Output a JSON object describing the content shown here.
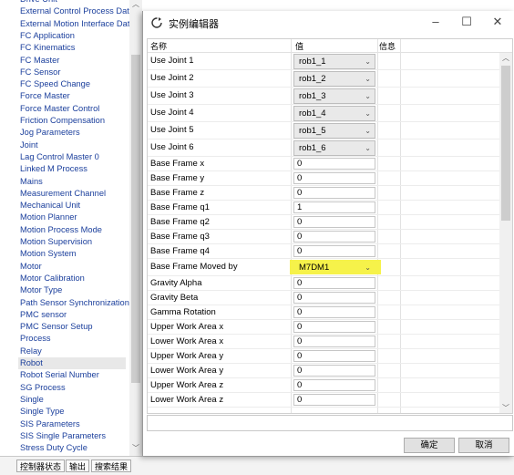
{
  "left_list": {
    "items": [
      "Drive Unit",
      "External Control Process Data",
      "External Motion Interface Data",
      "FC Application",
      "FC Kinematics",
      "FC Master",
      "FC Sensor",
      "FC Speed Change",
      "Force Master",
      "Force Master Control",
      "Friction Compensation",
      "Jog Parameters",
      "Joint",
      "Lag Control Master 0",
      "Linked M Process",
      "Mains",
      "Measurement Channel",
      "Mechanical Unit",
      "Motion Planner",
      "Motion Process Mode",
      "Motion Supervision",
      "Motion System",
      "Motor",
      "Motor Calibration",
      "Motor Type",
      "Path Sensor Synchronization",
      "PMC sensor",
      "PMC Sensor Setup",
      "Process",
      "Relay",
      "Robot",
      "Robot Serial Number",
      "SG Process",
      "Single",
      "Single Type",
      "SIS Parameters",
      "SIS Single Parameters",
      "Stress Duty Cycle"
    ],
    "selected": "Robot"
  },
  "bottom_tabs": [
    "控制器状态",
    "输出",
    "搜索结果"
  ],
  "dialog": {
    "title": "实例编辑器",
    "columns": {
      "name": "名称",
      "value": "值",
      "info": "信息"
    },
    "rows": [
      {
        "name": "Use Joint 1",
        "value": "rob1_1",
        "type": "select"
      },
      {
        "name": "Use Joint 2",
        "value": "rob1_2",
        "type": "select"
      },
      {
        "name": "Use Joint 3",
        "value": "rob1_3",
        "type": "select"
      },
      {
        "name": "Use Joint 4",
        "value": "rob1_4",
        "type": "select"
      },
      {
        "name": "Use Joint 5",
        "value": "rob1_5",
        "type": "select"
      },
      {
        "name": "Use Joint 6",
        "value": "rob1_6",
        "type": "select"
      },
      {
        "name": "Base Frame x",
        "value": "0",
        "type": "text"
      },
      {
        "name": "Base Frame y",
        "value": "0",
        "type": "text"
      },
      {
        "name": "Base Frame z",
        "value": "0",
        "type": "text"
      },
      {
        "name": "Base Frame q1",
        "value": "1",
        "type": "text"
      },
      {
        "name": "Base Frame q2",
        "value": "0",
        "type": "text"
      },
      {
        "name": "Base Frame q3",
        "value": "0",
        "type": "text"
      },
      {
        "name": "Base Frame q4",
        "value": "0",
        "type": "text"
      },
      {
        "name": "Base Frame Moved by",
        "value": "M7DM1",
        "type": "select",
        "highlight": true
      },
      {
        "name": "Gravity Alpha",
        "value": "0",
        "type": "text"
      },
      {
        "name": "Gravity Beta",
        "value": "0",
        "type": "text"
      },
      {
        "name": "Gamma Rotation",
        "value": "0",
        "type": "text"
      },
      {
        "name": "Upper Work Area x",
        "value": "0",
        "type": "text"
      },
      {
        "name": "Lower Work Area x",
        "value": "0",
        "type": "text"
      },
      {
        "name": "Upper Work Area y",
        "value": "0",
        "type": "text"
      },
      {
        "name": "Lower Work Area y",
        "value": "0",
        "type": "text"
      },
      {
        "name": "Upper Work Area z",
        "value": "0",
        "type": "text"
      },
      {
        "name": "Lower Work Area z",
        "value": "0",
        "type": "text"
      }
    ],
    "buttons": {
      "ok": "确定",
      "cancel": "取消"
    },
    "highlight_color": "#f6f24a"
  }
}
